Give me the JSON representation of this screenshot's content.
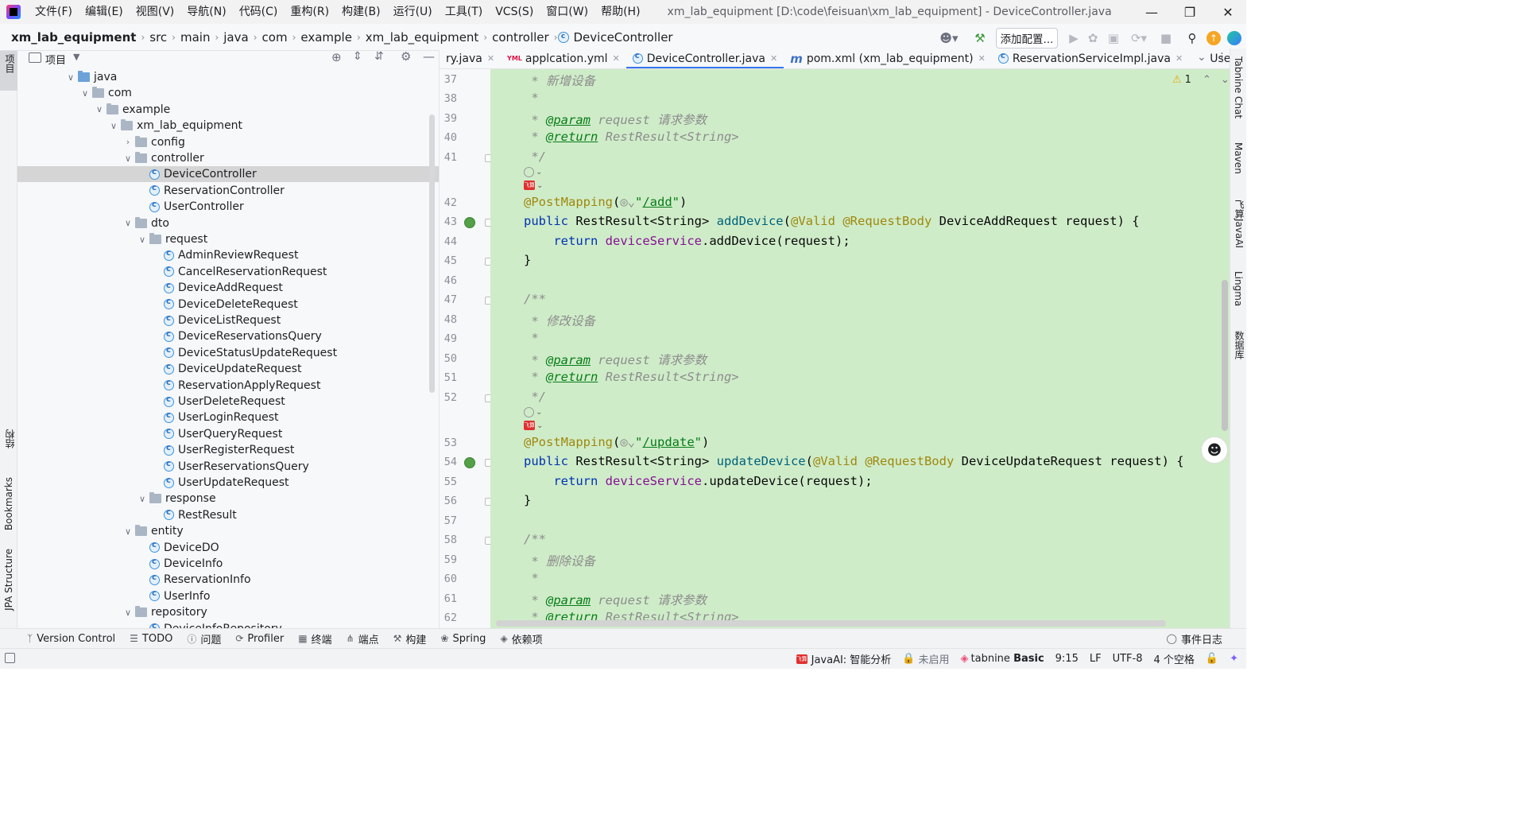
{
  "window": {
    "title": "xm_lab_equipment [D:\\code\\feisuan\\xm_lab_equipment] - DeviceController.java"
  },
  "menu": [
    "文件(F)",
    "编辑(E)",
    "视图(V)",
    "导航(N)",
    "代码(C)",
    "重构(R)",
    "构建(B)",
    "运行(U)",
    "工具(T)",
    "VCS(S)",
    "窗口(W)",
    "帮助(H)"
  ],
  "breadcrumb": [
    "xm_lab_equipment",
    "src",
    "main",
    "java",
    "com",
    "example",
    "xm_lab_equipment",
    "controller",
    "DeviceController"
  ],
  "toolbar": {
    "add_config_label": "添加配置..."
  },
  "left_stripe": {
    "project_label": "项目",
    "structure_label": "结构",
    "bookmarks_label": "Bookmarks",
    "jpa_label": "JPA Structure"
  },
  "project_panel": {
    "title": "项目",
    "tree": [
      {
        "label": "java",
        "type": "folder-blue",
        "indent": 0,
        "expanded": true
      },
      {
        "label": "com",
        "type": "folder",
        "indent": 1,
        "expanded": true
      },
      {
        "label": "example",
        "type": "folder",
        "indent": 2,
        "expanded": true
      },
      {
        "label": "xm_lab_equipment",
        "type": "folder",
        "indent": 3,
        "expanded": true
      },
      {
        "label": "config",
        "type": "folder",
        "indent": 4,
        "expanded": false
      },
      {
        "label": "controller",
        "type": "folder",
        "indent": 4,
        "expanded": true
      },
      {
        "label": "DeviceController",
        "type": "class",
        "indent": 5,
        "selected": true
      },
      {
        "label": "ReservationController",
        "type": "class",
        "indent": 5
      },
      {
        "label": "UserController",
        "type": "class",
        "indent": 5
      },
      {
        "label": "dto",
        "type": "folder",
        "indent": 4,
        "expanded": true
      },
      {
        "label": "request",
        "type": "folder",
        "indent": 5,
        "expanded": true
      },
      {
        "label": "AdminReviewRequest",
        "type": "class",
        "indent": 6
      },
      {
        "label": "CancelReservationRequest",
        "type": "class",
        "indent": 6
      },
      {
        "label": "DeviceAddRequest",
        "type": "class",
        "indent": 6
      },
      {
        "label": "DeviceDeleteRequest",
        "type": "class",
        "indent": 6
      },
      {
        "label": "DeviceListRequest",
        "type": "class",
        "indent": 6
      },
      {
        "label": "DeviceReservationsQuery",
        "type": "class",
        "indent": 6
      },
      {
        "label": "DeviceStatusUpdateRequest",
        "type": "class",
        "indent": 6
      },
      {
        "label": "DeviceUpdateRequest",
        "type": "class",
        "indent": 6
      },
      {
        "label": "ReservationApplyRequest",
        "type": "class",
        "indent": 6
      },
      {
        "label": "UserDeleteRequest",
        "type": "class",
        "indent": 6
      },
      {
        "label": "UserLoginRequest",
        "type": "class",
        "indent": 6
      },
      {
        "label": "UserQueryRequest",
        "type": "class",
        "indent": 6
      },
      {
        "label": "UserRegisterRequest",
        "type": "class",
        "indent": 6
      },
      {
        "label": "UserReservationsQuery",
        "type": "class",
        "indent": 6
      },
      {
        "label": "UserUpdateRequest",
        "type": "class",
        "indent": 6
      },
      {
        "label": "response",
        "type": "folder",
        "indent": 5,
        "expanded": true
      },
      {
        "label": "RestResult",
        "type": "class",
        "indent": 6
      },
      {
        "label": "entity",
        "type": "folder",
        "indent": 4,
        "expanded": true
      },
      {
        "label": "DeviceDO",
        "type": "class",
        "indent": 5
      },
      {
        "label": "DeviceInfo",
        "type": "class",
        "indent": 5
      },
      {
        "label": "ReservationInfo",
        "type": "class",
        "indent": 5
      },
      {
        "label": "UserInfo",
        "type": "class",
        "indent": 5
      },
      {
        "label": "repository",
        "type": "folder",
        "indent": 4,
        "expanded": true
      },
      {
        "label": "DeviceInfoRepository",
        "type": "class",
        "indent": 5
      }
    ]
  },
  "tabs": [
    {
      "label": "ry.java",
      "icon": "java"
    },
    {
      "label": "applcation.yml",
      "icon": "yml"
    },
    {
      "label": "DeviceController.java",
      "icon": "class",
      "active": true
    },
    {
      "label": "pom.xml (xm_lab_equipment)",
      "icon": "maven"
    },
    {
      "label": "ReservationServiceImpl.java",
      "icon": "class"
    },
    {
      "label": "UserServiceIm",
      "icon": "class"
    }
  ],
  "editor": {
    "warning_count": "1",
    "line_numbers": [
      "37",
      "38",
      "39",
      "40",
      "41",
      "42",
      "43",
      "44",
      "45",
      "46",
      "47",
      "48",
      "49",
      "50",
      "51",
      "52",
      "53",
      "54",
      "55",
      "56",
      "57",
      "58",
      "59",
      "60",
      "61",
      "62"
    ],
    "lines": {
      "l37_comment": "新增设备",
      "l39_tag": "@param",
      "l39_rest": " request ",
      "l39_desc": "请求参数",
      "l40_tag": "@return",
      "l40_rest": " RestResult<String>",
      "l42_ann": "@PostMapping",
      "l42_path": "/add",
      "l43_kw": "public",
      "l43_type": " RestResult<String> ",
      "l43_fn": "addDevice",
      "l43_params": "DeviceAddRequest request) {",
      "l44_call": "addDevice",
      "l48_comment": "修改设备",
      "l53_path": "/update",
      "l54_fn": "updateDevice",
      "l54_params": "DeviceUpdateRequest request) {",
      "l55_call": "updateDevice",
      "l59_comment": "删除设备",
      "valid": "@Valid",
      "reqbody": "@RequestBody",
      "ret": "return",
      "svc": "deviceService"
    }
  },
  "right_stripe": {
    "tabnine": "Tabnine Chat",
    "maven": "Maven",
    "javaai": "飞算JavaAI",
    "lingma": "Lingma",
    "database": "数据库"
  },
  "tool_windows": [
    "Version Control",
    "TODO",
    "问题",
    "Profiler",
    "终端",
    "端点",
    "构建",
    "Spring",
    "依赖项"
  ],
  "event_log": "事件日志",
  "status": {
    "javaai": "JavaAI: 智能分析",
    "disabled": "未启用",
    "tabnine": "tabnine",
    "tabnine_plan": "Basic",
    "position": "9:15",
    "line_sep": "LF",
    "encoding": "UTF-8",
    "indent": "4 个空格"
  }
}
